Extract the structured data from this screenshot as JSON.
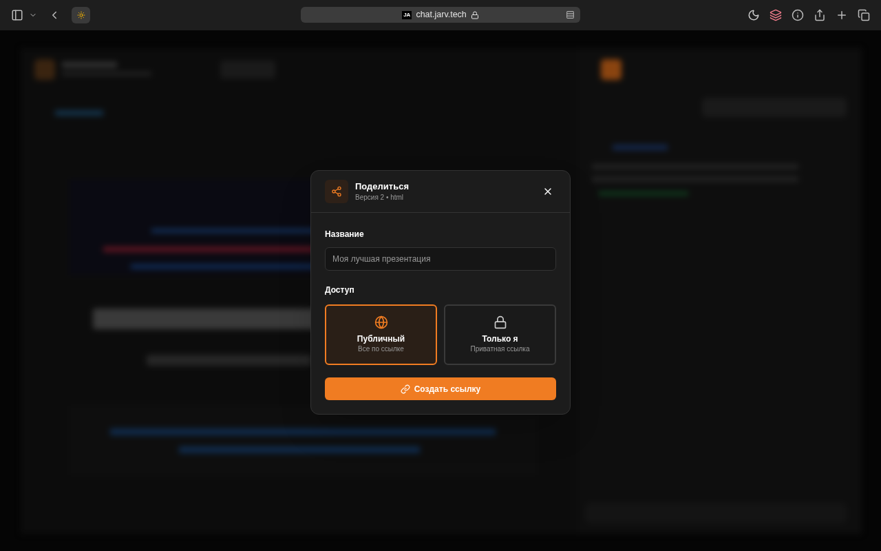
{
  "browser": {
    "favicon_text": "JA",
    "url": "chat.jarv.tech"
  },
  "dialog": {
    "title": "Поделиться",
    "subtitle": "Версия 2 • html",
    "name_label": "Название",
    "name_placeholder": "Моя лучшая презентация",
    "access_label": "Доступ",
    "options": [
      {
        "kind": "public",
        "label": "Публичный",
        "description": "Все по ссылке",
        "selected": true
      },
      {
        "kind": "private",
        "label": "Только я",
        "description": "Приватная ссылка",
        "selected": false
      }
    ],
    "create_button": "Создать ссылку"
  }
}
